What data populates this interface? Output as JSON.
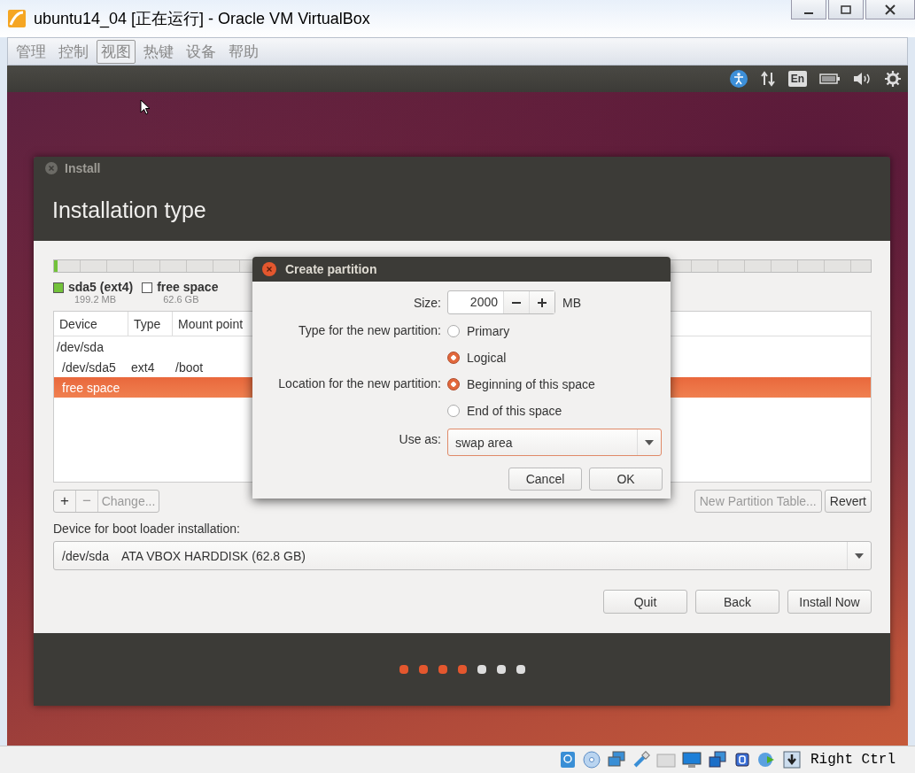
{
  "window": {
    "title": "ubuntu14_04 [正在运行] - Oracle VM VirtualBox"
  },
  "menu": [
    {
      "label": "管理",
      "selected": false
    },
    {
      "label": "控制",
      "selected": false
    },
    {
      "label": "视图",
      "selected": true
    },
    {
      "label": "热键",
      "selected": false
    },
    {
      "label": "设备",
      "selected": false
    },
    {
      "label": "帮助",
      "selected": false
    }
  ],
  "panel": {
    "keyboard_layout": "En"
  },
  "installer": {
    "title": "Install",
    "heading": "Installation type",
    "disk_bar": {
      "level": 0.004
    },
    "legend": [
      {
        "name": "sda5 (ext4)",
        "size": "199.2 MB",
        "color": "#73c23a"
      },
      {
        "name": "free space",
        "size": "62.6 GB",
        "color": "#ffffff"
      }
    ],
    "table": {
      "columns": [
        "Device",
        "Type",
        "Mount point"
      ],
      "rows": [
        {
          "cells": [
            "/dev/sda",
            "",
            ""
          ],
          "indent": false,
          "selected": false
        },
        {
          "cells": [
            "/dev/sda5",
            "ext4",
            "/boot"
          ],
          "indent": true,
          "selected": false
        },
        {
          "cells": [
            "free space",
            "",
            ""
          ],
          "indent": true,
          "selected": true
        }
      ]
    },
    "edit_buttons": [
      {
        "label": "+",
        "disabled": false
      },
      {
        "label": "−",
        "disabled": true
      },
      {
        "label": "Change...",
        "disabled": true
      }
    ],
    "table_buttons": [
      {
        "label": "New Partition Table...",
        "disabled": true
      },
      {
        "label": "Revert",
        "disabled": false
      }
    ],
    "boot_loader_label": "Device for boot loader installation:",
    "boot_loader_device": "/dev/sda",
    "boot_loader_disk": "ATA VBOX HARDDISK (62.8 GB)",
    "nav_buttons": [
      "Quit",
      "Back",
      "Install Now"
    ],
    "steps": [
      {
        "done": true
      },
      {
        "done": true
      },
      {
        "done": true
      },
      {
        "done": true
      },
      {
        "done": false
      },
      {
        "done": false
      },
      {
        "done": false
      }
    ]
  },
  "dialog": {
    "title": "Create partition",
    "size_label": "Size:",
    "size_value": "2000",
    "size_unit": "MB",
    "type_label": "Type for the new partition:",
    "type_options": [
      {
        "label": "Primary",
        "selected": false
      },
      {
        "label": "Logical",
        "selected": true
      }
    ],
    "location_label": "Location for the new partition:",
    "location_options": [
      {
        "label": "Beginning of this space",
        "selected": true
      },
      {
        "label": "End of this space",
        "selected": false
      }
    ],
    "use_as_label": "Use as:",
    "use_as_value": "swap area",
    "buttons": [
      "Cancel",
      "OK"
    ]
  },
  "status_bar": {
    "host_key": "Right Ctrl"
  }
}
